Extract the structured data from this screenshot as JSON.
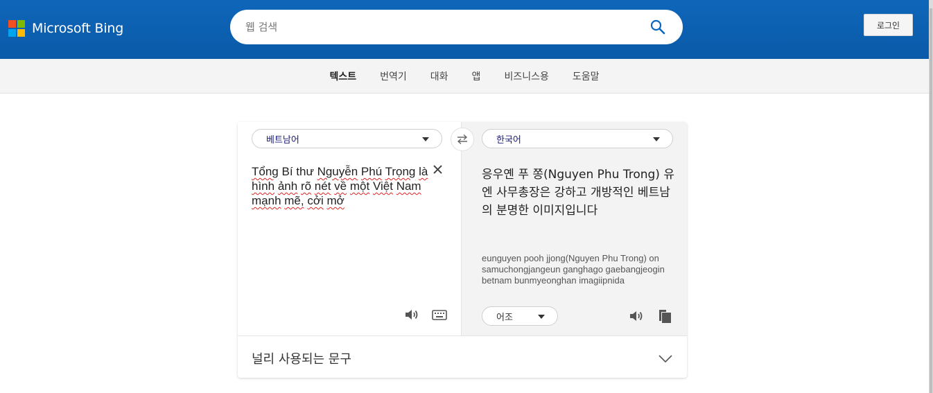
{
  "header": {
    "brand": "Microsoft Bing",
    "logo_colors": [
      "#f25022",
      "#7fba00",
      "#00a4ef",
      "#ffb900"
    ],
    "search_placeholder": "웹 검색",
    "search_icon": "search-icon",
    "login_label": "로그인",
    "background_color": "#0f66b9"
  },
  "nav": {
    "items": [
      {
        "label": "텍스트",
        "active": true
      },
      {
        "label": "번역기",
        "active": false
      },
      {
        "label": "대화",
        "active": false
      },
      {
        "label": "앱",
        "active": false
      },
      {
        "label": "비즈니스용",
        "active": false
      },
      {
        "label": "도움말",
        "active": false
      }
    ]
  },
  "translator": {
    "source_language": "베트남어",
    "target_language": "한국어",
    "swap_icon": "swap-icon",
    "source_text_words": [
      "Tổng",
      "Bí",
      "thư",
      "Nguyễn",
      "Phú",
      "Trọng",
      "là",
      "hình",
      "ảnh",
      "rõ",
      "nét",
      "về",
      "một",
      "Việt",
      "Nam",
      "mạnh",
      "mẽ,",
      "cởi",
      "mở"
    ],
    "translated_text": "응우옌 푸 쫑(Nguyen Phu Trong) 유엔 사무총장은 강하고 개방적인 베트남의 분명한 이미지입니다",
    "transliteration": "eunguyen pooh jjong(Nguyen Phu Trong) on samuchongjangeun ganghago gaebangjeogin betnam bunmyeonghan imagiipnida",
    "tone_label": "어조",
    "source_icons": [
      "speaker-icon",
      "keyboard-icon",
      "close-icon"
    ],
    "target_icons": [
      "speaker-icon",
      "copy-icon"
    ]
  },
  "phrases": {
    "label": "널리 사용되는 문구",
    "chevron": "chevron-down-icon"
  }
}
